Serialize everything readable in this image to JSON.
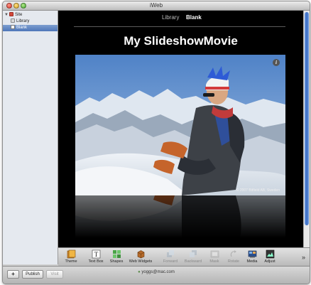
{
  "window": {
    "title": "iWeb"
  },
  "sidebar": {
    "items": [
      {
        "label": "Site"
      },
      {
        "label": "Library"
      },
      {
        "label": "Blank"
      }
    ]
  },
  "page": {
    "nav": [
      {
        "label": "Library"
      },
      {
        "label": "Blank"
      }
    ],
    "title": "My SlideshowMovie",
    "photo_credit": "© 2007 Bitfield AB, Sweden"
  },
  "toolbar": {
    "items": [
      {
        "label": "Theme",
        "icon": "theme-icon",
        "enabled": true
      },
      {
        "label": "Text Box",
        "icon": "text-box-icon",
        "enabled": true
      },
      {
        "label": "Shapes",
        "icon": "shapes-icon",
        "enabled": true
      },
      {
        "label": "Web Widgets",
        "icon": "web-widgets-icon",
        "enabled": true
      },
      {
        "label": "Forward",
        "icon": "forward-icon",
        "enabled": false
      },
      {
        "label": "Backward",
        "icon": "backward-icon",
        "enabled": false
      },
      {
        "label": "Mask",
        "icon": "mask-icon",
        "enabled": false
      },
      {
        "label": "Rotate",
        "icon": "rotate-icon",
        "enabled": false
      },
      {
        "label": "Media",
        "icon": "media-icon",
        "enabled": true
      },
      {
        "label": "Adjust",
        "icon": "adjust-icon",
        "enabled": true
      }
    ],
    "overflow": "»"
  },
  "bottom": {
    "add_label": "+",
    "publish_label": "Publish",
    "visit_label": "Visit",
    "status": "yoggs@mac.com"
  },
  "colors": {
    "canvas": "#000000",
    "selection": "#4e76b8",
    "scrollbar": "#3a6cc4"
  }
}
